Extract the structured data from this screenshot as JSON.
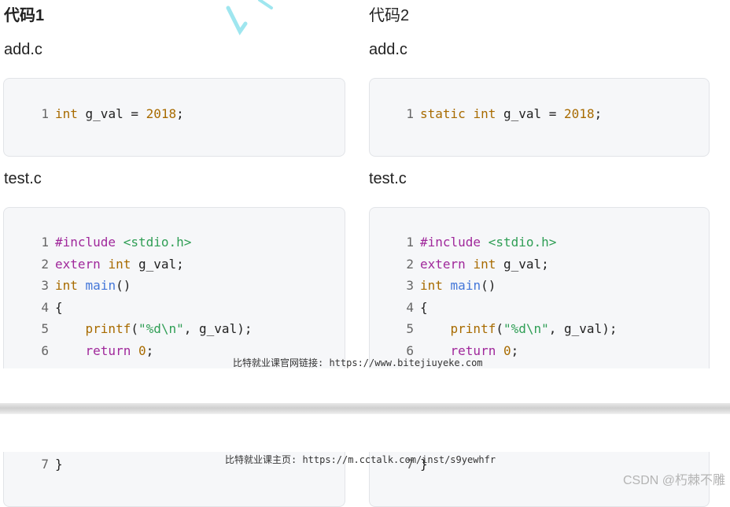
{
  "columns": [
    {
      "title": "代码1",
      "add_label": "add.c",
      "add_code": [
        {
          "ln": "1",
          "parts": [
            [
              "kw-orange",
              "int"
            ],
            [
              "plain",
              " g_val = "
            ],
            [
              "num",
              "2018"
            ],
            [
              "plain",
              ";"
            ]
          ]
        }
      ],
      "test_label": "test.c",
      "test_code": [
        {
          "ln": "1",
          "parts": [
            [
              "kw-purple",
              "#include"
            ],
            [
              "plain",
              " "
            ],
            [
              "str-green",
              "<stdio.h>"
            ]
          ]
        },
        {
          "ln": "2",
          "parts": [
            [
              "kw-purple",
              "extern"
            ],
            [
              "plain",
              " "
            ],
            [
              "kw-orange",
              "int"
            ],
            [
              "plain",
              " g_val;"
            ]
          ]
        },
        {
          "ln": "3",
          "parts": [
            [
              "kw-orange",
              "int"
            ],
            [
              "plain",
              " "
            ],
            [
              "kw-blue",
              "main"
            ],
            [
              "plain",
              "()"
            ]
          ]
        },
        {
          "ln": "4",
          "parts": [
            [
              "plain",
              "{"
            ]
          ]
        },
        {
          "ln": "5",
          "parts": [
            [
              "plain",
              "    "
            ],
            [
              "kw-orange",
              "printf"
            ],
            [
              "plain",
              "("
            ],
            [
              "str-green",
              "\"%d\\n\""
            ],
            [
              "plain",
              ", g_val);"
            ]
          ]
        },
        {
          "ln": "6",
          "parts": [
            [
              "plain",
              "    "
            ],
            [
              "kw-purple",
              "return"
            ],
            [
              "plain",
              " "
            ],
            [
              "num",
              "0"
            ],
            [
              "plain",
              ";"
            ]
          ]
        }
      ],
      "test_code_cont": [
        {
          "ln": "7",
          "parts": [
            [
              "plain",
              "}"
            ]
          ]
        }
      ]
    },
    {
      "title": "代码2",
      "add_label": "add.c",
      "add_code": [
        {
          "ln": "1",
          "parts": [
            [
              "kw-orange",
              "static"
            ],
            [
              "plain",
              " "
            ],
            [
              "kw-orange",
              "int"
            ],
            [
              "plain",
              " g_val = "
            ],
            [
              "num",
              "2018"
            ],
            [
              "plain",
              ";"
            ]
          ]
        }
      ],
      "test_label": "test.c",
      "test_code": [
        {
          "ln": "1",
          "parts": [
            [
              "kw-purple",
              "#include"
            ],
            [
              "plain",
              " "
            ],
            [
              "str-green",
              "<stdio.h>"
            ]
          ]
        },
        {
          "ln": "2",
          "parts": [
            [
              "kw-purple",
              "extern"
            ],
            [
              "plain",
              " "
            ],
            [
              "kw-orange",
              "int"
            ],
            [
              "plain",
              " g_val;"
            ]
          ]
        },
        {
          "ln": "3",
          "parts": [
            [
              "kw-orange",
              "int"
            ],
            [
              "plain",
              " "
            ],
            [
              "kw-blue",
              "main"
            ],
            [
              "plain",
              "()"
            ]
          ]
        },
        {
          "ln": "4",
          "parts": [
            [
              "plain",
              "{"
            ]
          ]
        },
        {
          "ln": "5",
          "parts": [
            [
              "plain",
              "    "
            ],
            [
              "kw-orange",
              "printf"
            ],
            [
              "plain",
              "("
            ],
            [
              "str-green",
              "\"%d\\n\""
            ],
            [
              "plain",
              ", g_val);"
            ]
          ]
        },
        {
          "ln": "6",
          "parts": [
            [
              "plain",
              "    "
            ],
            [
              "kw-purple",
              "return"
            ],
            [
              "plain",
              " "
            ],
            [
              "num",
              "0"
            ],
            [
              "plain",
              ";"
            ]
          ]
        }
      ],
      "test_code_cont": [
        {
          "ln": "7",
          "parts": [
            [
              "plain",
              "}"
            ]
          ]
        }
      ]
    }
  ],
  "footer": {
    "page1_text": "比特就业课官网链接: https://www.bitejiuyeke.com",
    "page2_text": "比特就业课主页: https://m.cctalk.com/inst/s9yewhfr"
  },
  "watermark": "CSDN @朽棘不雕"
}
